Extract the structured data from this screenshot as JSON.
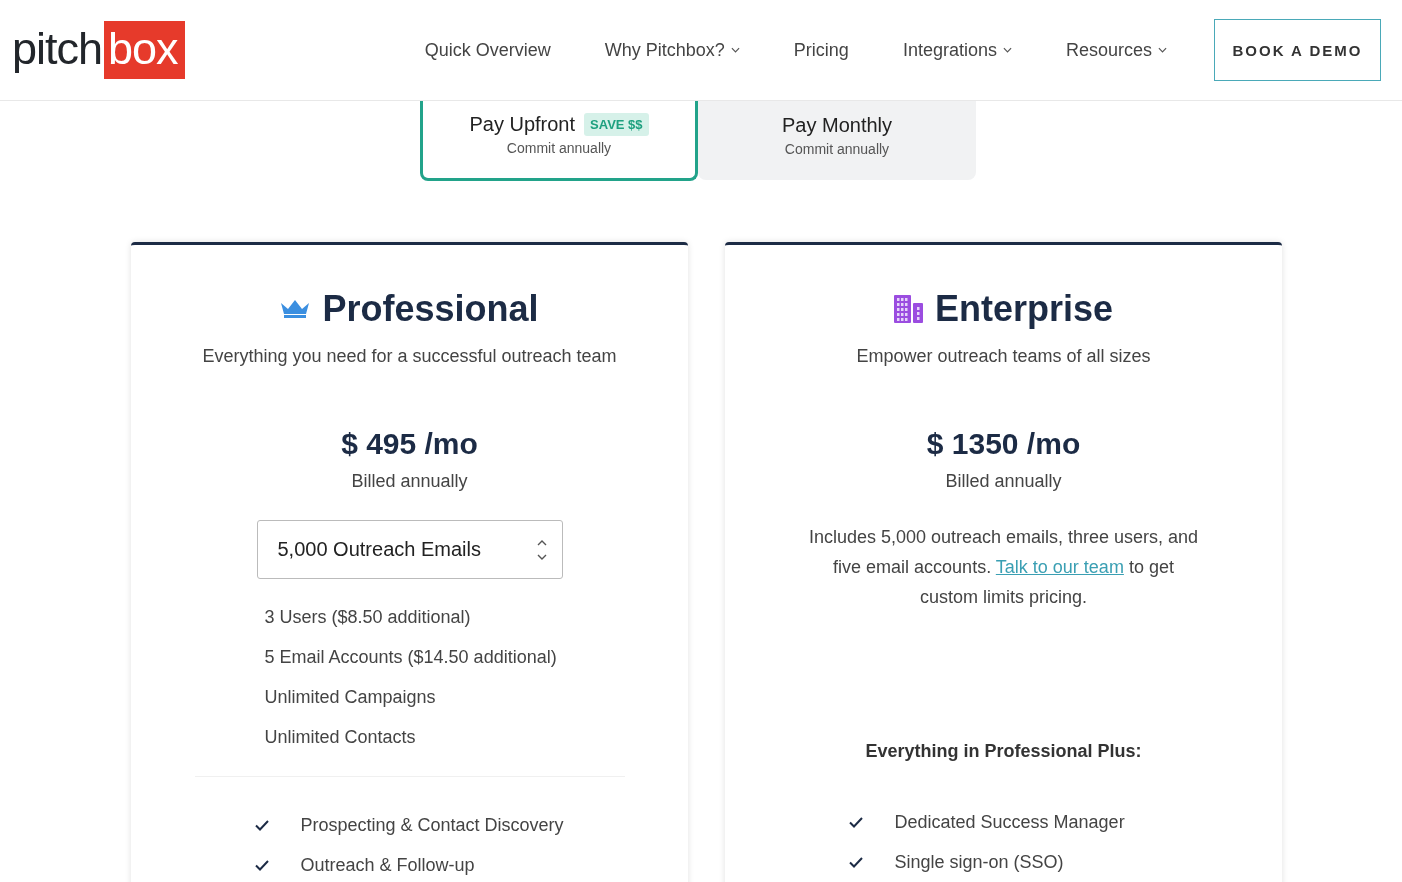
{
  "header": {
    "logo": {
      "dark_part": "pitch",
      "boxed_part": "box"
    },
    "nav": [
      {
        "label": "Quick Overview",
        "dropdown": false
      },
      {
        "label": "Why Pitchbox?",
        "dropdown": true
      },
      {
        "label": "Pricing",
        "dropdown": false
      },
      {
        "label": "Integrations",
        "dropdown": true
      },
      {
        "label": "Resources",
        "dropdown": true
      }
    ],
    "cta": "BOOK A DEMO"
  },
  "billing_options": [
    {
      "label": "Pay Upfront",
      "badge": "SAVE $$",
      "sub": "Commit annually",
      "selected": true
    },
    {
      "label": "Pay Monthly",
      "sub": "Commit annually",
      "selected": false
    }
  ],
  "plans": [
    {
      "kind": "crown",
      "name": "Professional",
      "tagline": "Everything you need for a successful outreach team",
      "price": "$ 495 /mo",
      "billing": "Billed annually",
      "selector": "5,000 Outreach Emails",
      "allowances": [
        "3 Users ($8.50 additional)",
        "5 Email Accounts ($14.50 additional)",
        "Unlimited Campaigns",
        "Unlimited Contacts"
      ],
      "features": [
        "Prospecting & Contact Discovery",
        "Outreach & Follow-up"
      ]
    },
    {
      "kind": "building",
      "name": "Enterprise",
      "tagline": "Empower outreach teams of all sizes",
      "price": "$ 1350 /mo",
      "billing": "Billed annually",
      "description": {
        "before": "Includes 5,000 outreach emails, three users, and five email accounts.",
        "link": "Talk to our team",
        "after": "to get custom limits pricing."
      },
      "features_heading": "Everything in Professional Plus:",
      "features": [
        "Dedicated Success Manager",
        "Single sign-on (SSO)"
      ]
    }
  ]
}
